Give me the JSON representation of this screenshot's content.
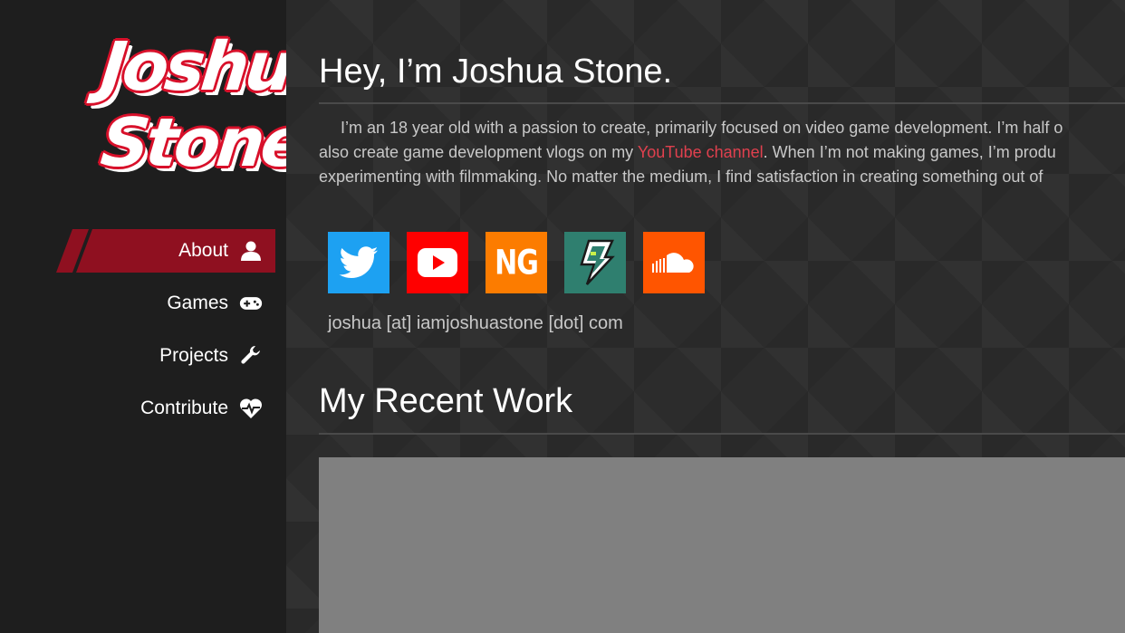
{
  "sidebar": {
    "logo": {
      "line1": "Joshua",
      "line2": "Stone"
    },
    "nav": [
      {
        "label": "About",
        "icon": "user-icon",
        "active": true
      },
      {
        "label": "Games",
        "icon": "gamepad-icon",
        "active": false
      },
      {
        "label": "Projects",
        "icon": "wrench-icon",
        "active": false
      },
      {
        "label": "Contribute",
        "icon": "heartbeat-icon",
        "active": false
      }
    ]
  },
  "main": {
    "title": "Hey, I’m Joshua Stone.",
    "intro": {
      "line1": "I’m an 18 year old with a passion to create, primarily focused on video game development. I’m half o",
      "line2_before": "also create game development vlogs on my ",
      "line2_link": "YouTube channel",
      "line2_after": ". When I’m not making games, I’m produ",
      "line3": "experimenting with filmmaking. No matter the medium, I find satisfaction in creating something out of"
    },
    "socials": [
      {
        "name": "twitter",
        "icon": "twitter-icon",
        "color": "#1da1f2"
      },
      {
        "name": "youtube",
        "icon": "youtube-icon",
        "color": "#ff0000"
      },
      {
        "name": "newgrounds",
        "icon": "newgrounds-icon",
        "color": "#fc7c00",
        "label": "NG"
      },
      {
        "name": "gamejolt",
        "icon": "gamejolt-icon",
        "color": "#2f7f6f"
      },
      {
        "name": "soundcloud",
        "icon": "soundcloud-icon",
        "color": "#ff5500"
      }
    ],
    "email": "joshua [at] iamjoshuastone [dot] com",
    "recent_heading": "My Recent Work"
  },
  "colors": {
    "accent": "#8f1020",
    "link": "#e0404e",
    "logo_red": "#d8102a"
  }
}
